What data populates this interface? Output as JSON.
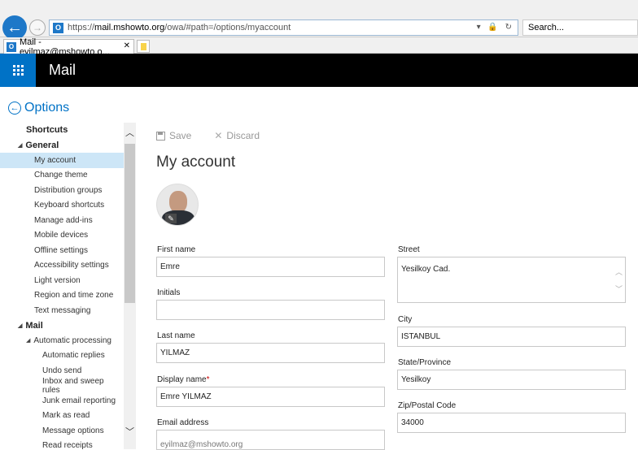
{
  "browser": {
    "url_prefix": "https://",
    "url_host": "mail.mshowto.org",
    "url_path": "/owa/#path=/options/myaccount",
    "url_icons": "▾ 🔒 ↻",
    "search_placeholder": "Search...",
    "tab_title": "Mail - eyilmaz@mshowto.o...",
    "tab_close": "✕",
    "favicon_text": "O"
  },
  "header": {
    "app_title": "Mail"
  },
  "options": {
    "label": "Options",
    "back_icon": "←"
  },
  "sidebar": {
    "items": [
      {
        "label": "Shortcuts",
        "level": 0,
        "heading": true,
        "tri": ""
      },
      {
        "label": "General",
        "level": 0,
        "heading": true,
        "tri": "◢"
      },
      {
        "label": "My account",
        "level": 1,
        "selected": true
      },
      {
        "label": "Change theme",
        "level": 1
      },
      {
        "label": "Distribution groups",
        "level": 1
      },
      {
        "label": "Keyboard shortcuts",
        "level": 1
      },
      {
        "label": "Manage add-ins",
        "level": 1
      },
      {
        "label": "Mobile devices",
        "level": 1
      },
      {
        "label": "Offline settings",
        "level": 1
      },
      {
        "label": "Accessibility settings",
        "level": 1
      },
      {
        "label": "Light version",
        "level": 1
      },
      {
        "label": "Region and time zone",
        "level": 1
      },
      {
        "label": "Text messaging",
        "level": 1
      },
      {
        "label": "Mail",
        "level": 0,
        "heading": true,
        "tri": "◢"
      },
      {
        "label": "Automatic processing",
        "level": 1,
        "tri": "◢"
      },
      {
        "label": "Automatic replies",
        "level": 2
      },
      {
        "label": "Undo send",
        "level": 2
      },
      {
        "label": "Inbox and sweep rules",
        "level": 2
      },
      {
        "label": "Junk email reporting",
        "level": 2
      },
      {
        "label": "Mark as read",
        "level": 2
      },
      {
        "label": "Message options",
        "level": 2
      },
      {
        "label": "Read receipts",
        "level": 2
      }
    ],
    "scroll_up": "︿",
    "scroll_down": "﹀"
  },
  "toolbar": {
    "save_label": "Save",
    "discard_label": "Discard",
    "discard_icon": "✕"
  },
  "page": {
    "title": "My account"
  },
  "form": {
    "first_name": {
      "label": "First name",
      "value": "Emre"
    },
    "initials": {
      "label": "Initials",
      "value": ""
    },
    "last_name": {
      "label": "Last name",
      "value": "YILMAZ"
    },
    "display_name": {
      "label": "Display name",
      "required_mark": "*",
      "value": "Emre YILMAZ"
    },
    "email": {
      "label": "Email address",
      "value": "eyilmaz@mshowto.org"
    },
    "street": {
      "label": "Street",
      "value": "Yesilkoy Cad."
    },
    "city": {
      "label": "City",
      "value": "ISTANBUL"
    },
    "state": {
      "label": "State/Province",
      "value": "Yesilkoy"
    },
    "zip": {
      "label": "Zip/Postal Code",
      "value": "34000"
    }
  },
  "colors": {
    "accent": "#0072c6",
    "header_bg": "#000000",
    "selected_bg": "#cde6f7"
  }
}
